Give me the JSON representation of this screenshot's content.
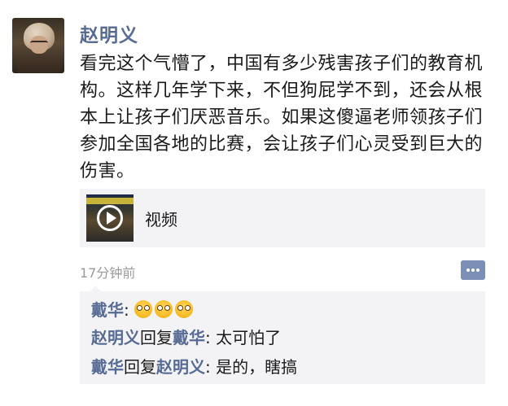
{
  "post": {
    "author": "赵明义",
    "text": "看完这个气懵了，中国有多少残害孩子们的教育机构。这样几年学下来，不但狗屁学不到，还会从根本上让孩子们厌恶音乐。如果这傻逼老师领孩子们参加全国各地的比赛，会让孩子们心灵受到巨大的伤害。",
    "video_label": "视频",
    "time": "17分钟前"
  },
  "comments": [
    {
      "author": "戴华",
      "separator": ": ",
      "emoji_name": "dizzy-face-emoji",
      "emoji_count": 3
    },
    {
      "author": "赵明义",
      "reply_word": "回复",
      "reply_to": "戴华",
      "separator": ": ",
      "text": "太可怕了"
    },
    {
      "author": "戴华",
      "reply_word": "回复",
      "reply_to": "赵明义",
      "separator": ": ",
      "text": "是的，瞎搞"
    }
  ],
  "colors": {
    "name_link": "#576b95",
    "text": "#1a1a1a",
    "meta": "#9a9a9a",
    "panel_bg": "#f3f3f5",
    "comment_button": "#7b8fb5"
  }
}
